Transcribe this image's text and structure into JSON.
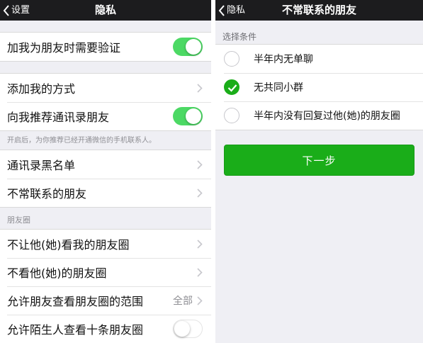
{
  "left": {
    "nav": {
      "back_label": "设置",
      "title": "隐私"
    },
    "group1": [
      {
        "label": "加我为朋友时需要验证",
        "toggle": true
      }
    ],
    "group2": [
      {
        "label": "添加我的方式"
      },
      {
        "label": "向我推荐通讯录朋友",
        "toggle": true
      }
    ],
    "group2_note": "开启后，为你推荐已经开通微信的手机联系人。",
    "group3": [
      {
        "label": "通讯录黑名单"
      },
      {
        "label": "不常联系的朋友"
      }
    ],
    "moments_header": "朋友圈",
    "group4": [
      {
        "label": "不让他(她)看我的朋友圈"
      },
      {
        "label": "不看他(她)的朋友圈"
      },
      {
        "label": "允许朋友查看朋友圈的范围",
        "value": "全部"
      },
      {
        "label": "允许陌生人查看十条朋友圈",
        "toggle": false
      }
    ]
  },
  "right": {
    "nav": {
      "back_label": "隐私",
      "title": "不常联系的朋友"
    },
    "section_header": "选择条件",
    "options": [
      {
        "label": "半年内无单聊",
        "checked": false
      },
      {
        "label": "无共同小群",
        "checked": true
      },
      {
        "label": "半年内没有回复过他(她)的朋友圈",
        "checked": false
      }
    ],
    "next_button": "下一步"
  },
  "colors": {
    "toggle_on": "#4cd964",
    "wechat_green": "#1aad19",
    "navbar": "#1c1c1e",
    "background": "#efeff4"
  }
}
